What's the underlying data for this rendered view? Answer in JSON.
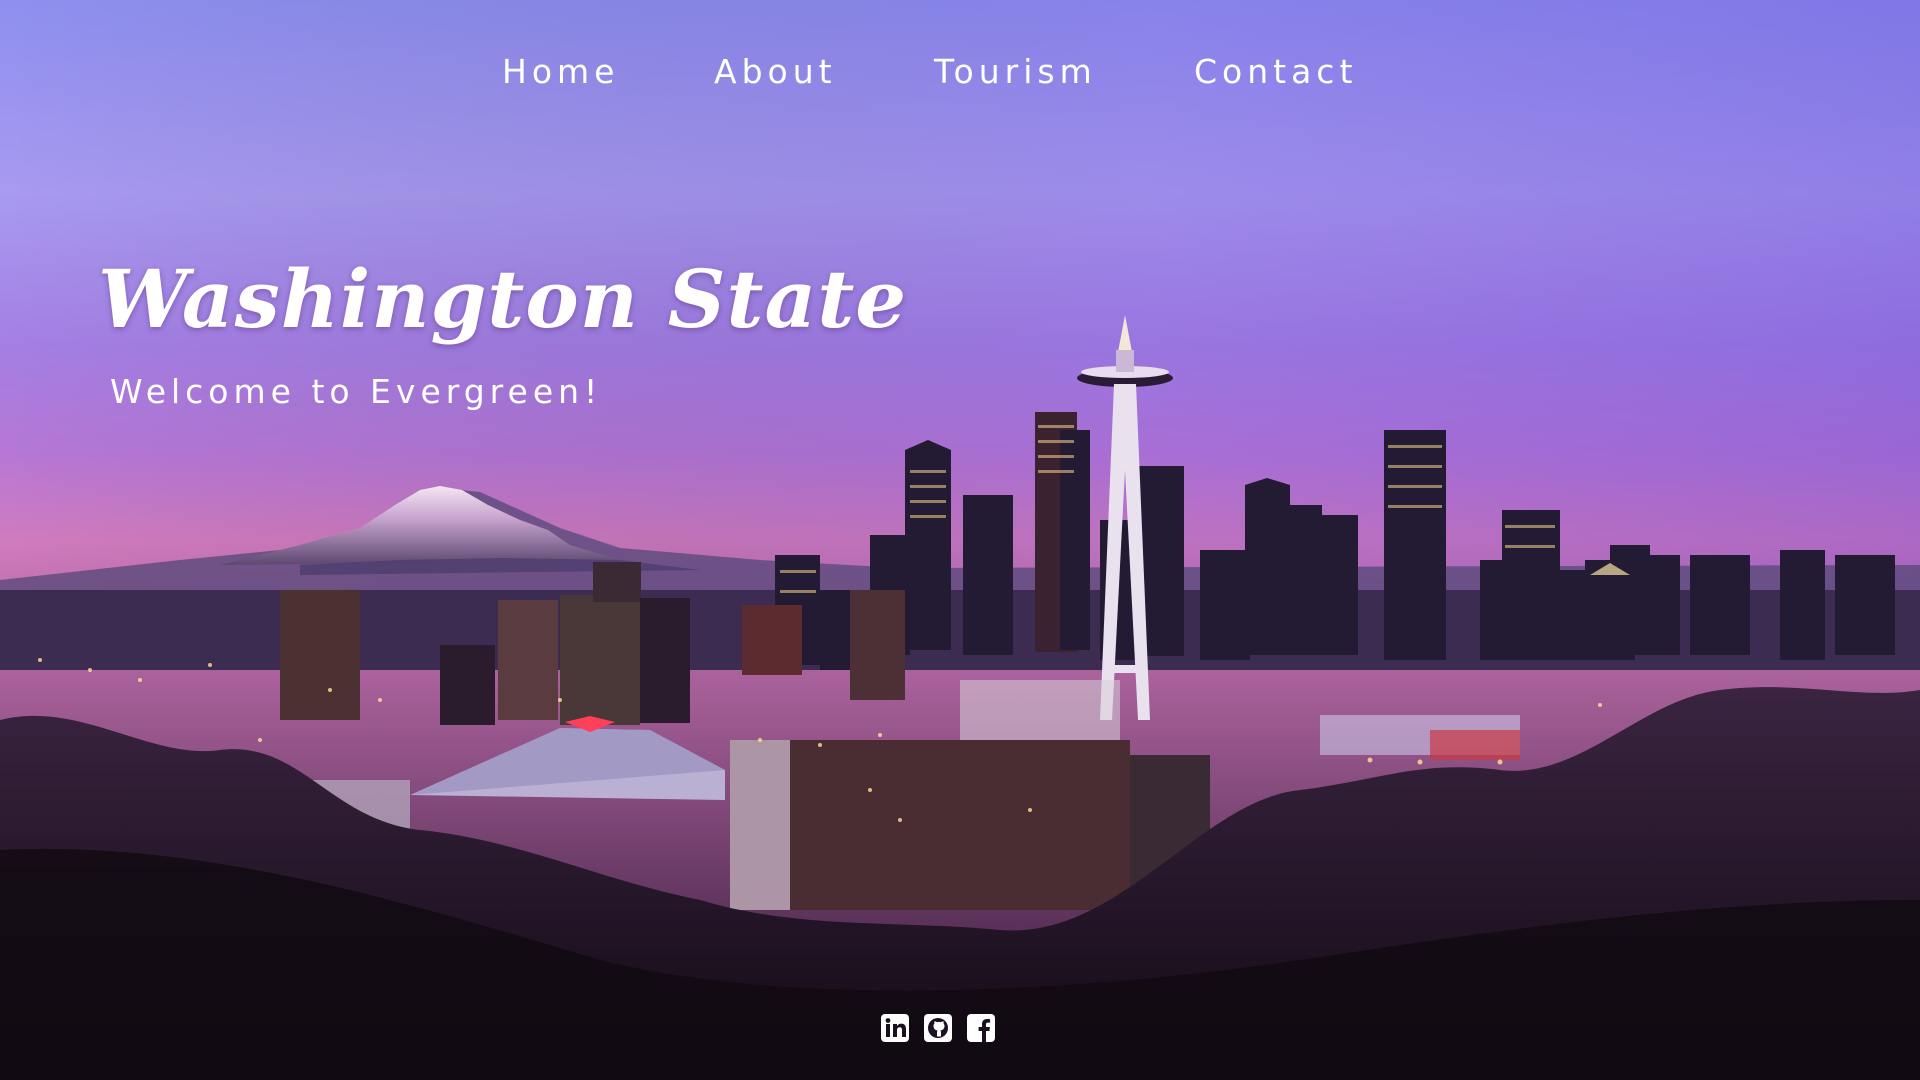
{
  "nav": {
    "items": [
      {
        "label": "Home"
      },
      {
        "label": "About"
      },
      {
        "label": "Tourism"
      },
      {
        "label": "Contact"
      }
    ]
  },
  "hero": {
    "title": "Washington State",
    "subtitle": "Welcome to Evergreen!"
  },
  "social": {
    "icons": [
      "linkedin-icon",
      "github-icon",
      "facebook-icon"
    ]
  },
  "colors": {
    "sky_top": "#8e8ff0",
    "sky_mid": "#a477e2",
    "sky_horizon": "#d879b4",
    "text": "#ffffff"
  }
}
